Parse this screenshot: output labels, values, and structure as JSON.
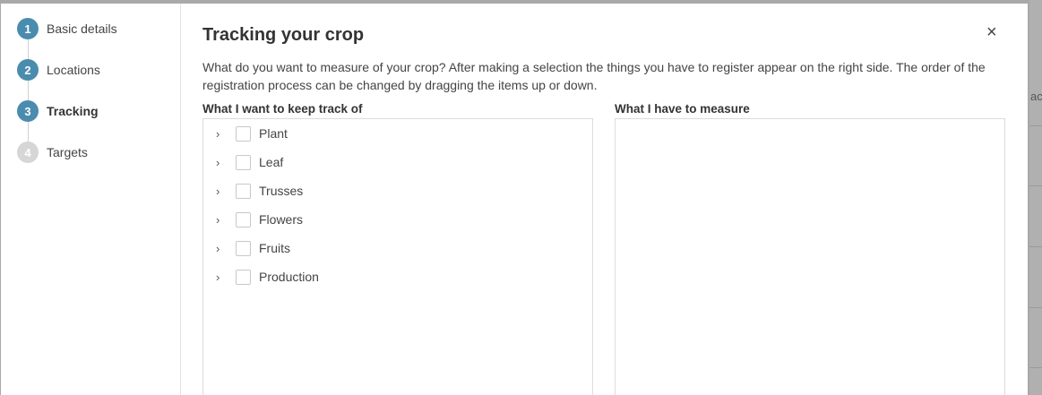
{
  "steps": [
    {
      "number": "1",
      "label": "Basic details",
      "state": "done"
    },
    {
      "number": "2",
      "label": "Locations",
      "state": "done"
    },
    {
      "number": "3",
      "label": "Tracking",
      "state": "active"
    },
    {
      "number": "4",
      "label": "Targets",
      "state": "inactive"
    }
  ],
  "modal": {
    "title": "Tracking your crop",
    "close_symbol": "×",
    "description": "What do you want to measure of your crop? After making a selection the things you have to register appear on the right side. The order of the registration process can be changed by dragging the items up or down."
  },
  "left_panel": {
    "title": "What I want to keep track of",
    "items": [
      "Plant",
      "Leaf",
      "Trusses",
      "Flowers",
      "Fruits",
      "Production"
    ]
  },
  "right_panel": {
    "title": "What I have to measure"
  },
  "background": {
    "cut_text": "act"
  },
  "colors": {
    "step_active": "#4a8cae",
    "step_inactive": "#d6d6d6"
  }
}
